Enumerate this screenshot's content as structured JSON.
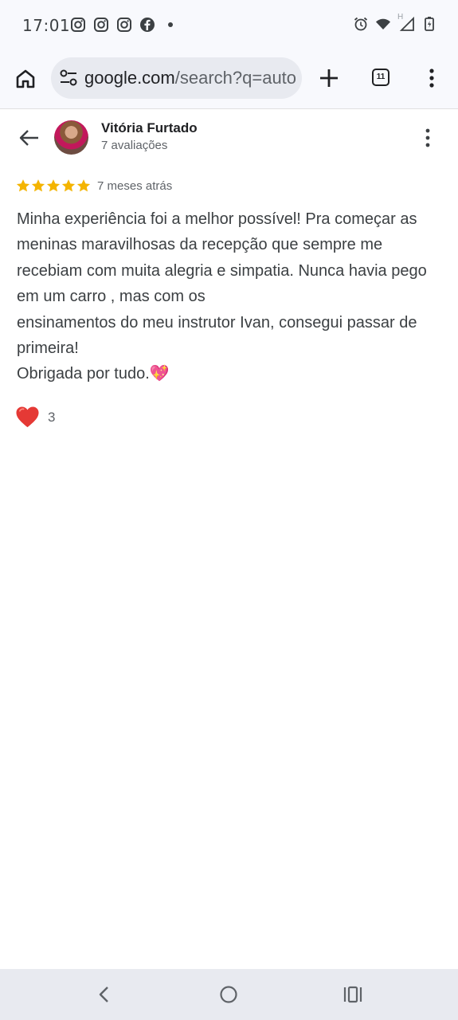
{
  "status_bar": {
    "time": "17:01",
    "left_icons": [
      "instagram-icon",
      "instagram-icon",
      "instagram-icon",
      "facebook-icon",
      "dot-icon"
    ],
    "right_icons": [
      "alarm-icon",
      "wifi-icon",
      "signal-icon",
      "battery-icon"
    ],
    "network_label": "H"
  },
  "browser": {
    "url_host": "google.com",
    "url_path": "/search?q=auto",
    "tab_count": "11"
  },
  "review": {
    "reviewer_name": "Vitória Furtado",
    "reviewer_reviews": "7 avaliações",
    "rating": 5,
    "max_rating": 5,
    "time_ago": "7 meses atrás",
    "text": "Minha experiência foi a melhor possível! Pra começar as meninas maravilhosas da recepção que sempre me recebiam com muita alegria e simpatia. Nunca havia pego em um carro , mas com os\nensinamentos do meu instrutor Ivan, consegui passar de primeira!\nObrigada por tudo.💖",
    "reactions": {
      "emoji": "heart",
      "count": "3"
    }
  },
  "colors": {
    "star": "#f4b400",
    "heart": "#e53935",
    "chrome_bg": "#f8f9fd",
    "nav_bg": "#e8eaf0"
  }
}
